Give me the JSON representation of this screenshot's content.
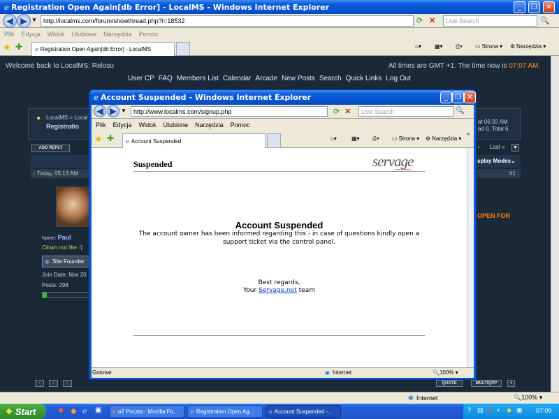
{
  "outer_window": {
    "title": "Registration Open Again[db Error] - LocalMS - Windows Internet Explorer",
    "address": "http://localms.com/forum/showthread.php?t=18532",
    "search_placeholder": "Live Search",
    "menu": [
      "Plik",
      "Edycja",
      "Widok",
      "Ulubione",
      "Narzędzia",
      "Pomoc"
    ],
    "tab_title": "Registration Open Again[db Error] - LocalMS",
    "toolbar": {
      "page": "Strona",
      "tools": "Narzędzia"
    },
    "status_zone": "Internet",
    "zoom": "100%"
  },
  "forum": {
    "welcome": "Welcome back to LocalMS: Relosu",
    "time_notice_prefix": "All times are GMT +1. The time now is",
    "time_now": "07:07 AM.",
    "nav": [
      "User CP",
      "FAQ",
      "Members List",
      "Calendar",
      "Arcade",
      "New Posts",
      "Search",
      "Quick Links",
      "Log Out"
    ],
    "breadcrumb_site": "LocalMS",
    "breadcrumb_sep": ">",
    "breadcrumb_frag": "Local",
    "thread_frag": "Registratio",
    "last_visit_frag": "at 06:32 AM",
    "online_frag": "ad 0, Total 6.",
    "add_reply": "ADD REPLY",
    "last_label": "Last »",
    "display_modes": "splay Modes",
    "post_date": "Today, 05:13 AM",
    "post_number": "#1",
    "open_for": "OPEN FOR",
    "username": "Paul",
    "name_label": "Name:",
    "user_title": "Clown not like :'(",
    "founder_badge": "Site Founder",
    "join_date": "Join Date: Nov 20",
    "posts": "Posts: 298",
    "quote_btn": "QUOTE",
    "multi_btn": "MULTIQPP"
  },
  "popup": {
    "title": "Account Suspended - Windows Internet Explorer",
    "address": "http://www.localms.com/signup.php",
    "search_placeholder": "Live Search",
    "menu": [
      "Plik",
      "Edycja",
      "Widok",
      "Ulubione",
      "Narzędzia",
      "Pomoc"
    ],
    "tab_title": "Account Suspended",
    "toolbar": {
      "page": "Strona",
      "tools": "Narzędzia"
    },
    "header_label": "Suspended",
    "logo_text": "servage",
    "logo_sub": "one solution",
    "heading": "Account Suspended",
    "message": "The account owner has been informed regarding this - in case of questions kindly open a support ticket via the control panel.",
    "regards": "Best regards,",
    "your": "Your",
    "link": "Servage.net",
    "team": "team",
    "status_left": "Gotowe",
    "status_zone": "Internet",
    "zoom": "100%"
  },
  "taskbar": {
    "start": "Start",
    "items": [
      "o2 Poczta - Mozilla Fir...",
      "Registration Open Ag...",
      "Account Suspended -..."
    ],
    "clock": "07:09"
  },
  "colors": {
    "xp_blue": "#0a5bd8",
    "forum_bg": "#1b2838",
    "accent_orange": "#ff7a00",
    "link_blue": "#0033cc"
  }
}
